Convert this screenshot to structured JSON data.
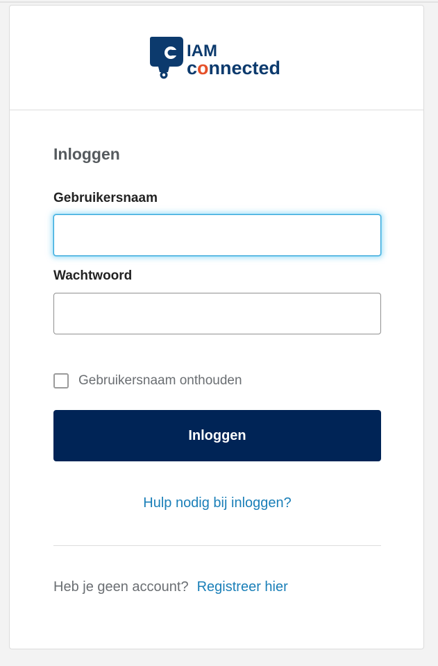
{
  "brand": {
    "logo_name": "iam-connected-logo",
    "line1": "IAM",
    "line2_prefix": "c",
    "line2_accent": "o",
    "line2_suffix": "nnected",
    "colors": {
      "navy": "#0c3a6d",
      "accent": "#e5512a"
    }
  },
  "form": {
    "title": "Inloggen",
    "username_label": "Gebruikersnaam",
    "username_value": "",
    "password_label": "Wachtwoord",
    "password_value": "",
    "remember_label": "Gebruikersnaam onthouden",
    "remember_checked": false,
    "submit_label": "Inloggen",
    "help_link": "Hulp nodig bij inloggen?"
  },
  "register": {
    "prompt": "Heb je geen account?",
    "link": "Registreer hier"
  },
  "colors": {
    "button": "#002456",
    "link": "#1a7fb8",
    "focus": "#3aa6d8"
  }
}
